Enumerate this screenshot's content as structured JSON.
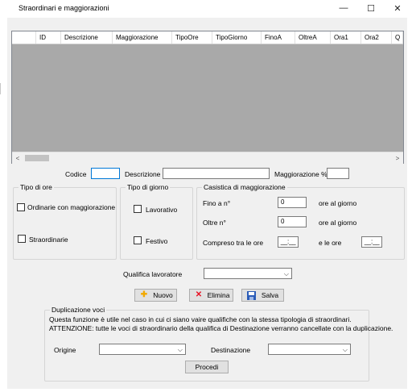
{
  "window": {
    "title": "Straordinari e maggiorazioni",
    "controls": {
      "minimize": "—",
      "maximize": "☐",
      "close": "✕"
    }
  },
  "grid": {
    "columns": [
      "",
      "ID",
      "Descrizione",
      "Maggiorazione",
      "TipoOre",
      "TipoGiorno",
      "FinoA",
      "OltreA",
      "Ora1",
      "Ora2",
      "Q"
    ],
    "scroll_left": "<",
    "scroll_right": ">"
  },
  "form": {
    "codice_label": "Codice",
    "codice_value": "",
    "descrizione_label": "Descrizione",
    "descrizione_value": "",
    "maggiorazione_label": "Maggiorazione %",
    "maggiorazione_value": ""
  },
  "tipo_ore": {
    "title": "Tipo di ore",
    "ordinarie_label": "Ordinarie con maggiorazione",
    "straordinarie_label": "Straordinarie"
  },
  "tipo_giorno": {
    "title": "Tipo di giorno",
    "lavorativo_label": "Lavorativo",
    "festivo_label": "Festivo"
  },
  "casistica": {
    "title": "Casistica di maggiorazione",
    "fino_label": "Fino a n°",
    "fino_value": "0",
    "fino_unit": "ore al giorno",
    "oltre_label": "Oltre n°",
    "oltre_value": "0",
    "oltre_unit": "ore al giorno",
    "compreso_label": "Compreso tra le ore",
    "compreso_from": "__:__",
    "e_le_ore_label": "e le ore",
    "compreso_to": "__:__"
  },
  "qualifica": {
    "label": "Qualifica lavoratore",
    "value": ""
  },
  "actions": {
    "nuovo": "Nuovo",
    "elimina": "Elimina",
    "salva": "Salva"
  },
  "duplicazione": {
    "title": "Duplicazione voci",
    "info_line1": "Questa funzione è utile nel caso in cui ci siano vaire qualifiche con la stessa tipologia di straordinari.",
    "info_line2": "ATTENZIONE: tutte le voci di straordinario della qualifica di Destinazione verranno cancellate con la duplicazione.",
    "origine_label": "Origine",
    "origine_value": "",
    "destinazione_label": "Destinazione",
    "destinazione_value": "",
    "procedi": "Procedi"
  },
  "colors": {
    "window_bg": "#f0f0f0",
    "grid_bg": "#a9a9a9",
    "focus_border": "#0078d7",
    "elimina_icon": "#e81123",
    "nuovo_icon": "#f2a900",
    "salva_icon": "#2b5cb8"
  }
}
